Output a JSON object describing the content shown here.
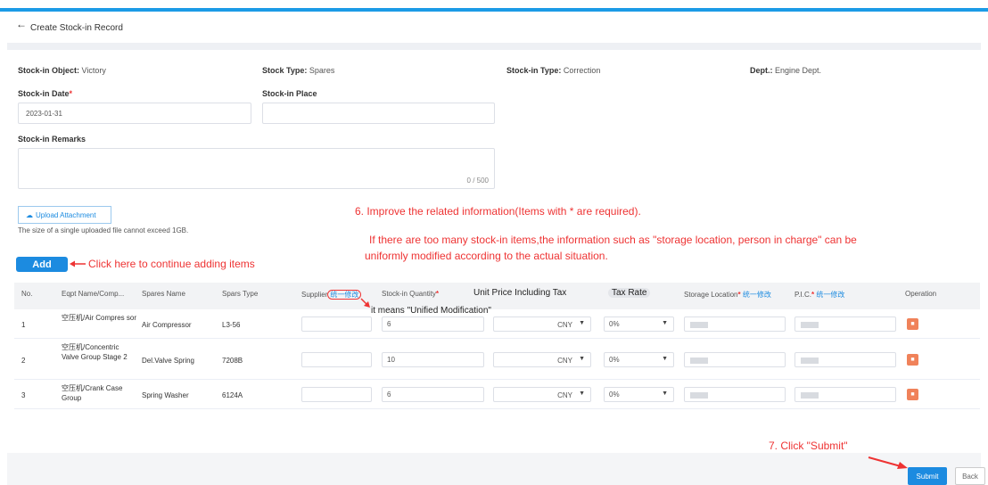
{
  "header": {
    "back_icon": "←",
    "title": "Create Stock-in Record"
  },
  "info": {
    "stock_in_object_label": "Stock-in Object:",
    "stock_in_object_value": "Victory",
    "stock_type_label": "Stock Type:",
    "stock_type_value": "Spares",
    "stock_in_type_label": "Stock-in Type:",
    "stock_in_type_value": "Correction",
    "dept_label": "Dept.:",
    "dept_value": "Engine Dept."
  },
  "form": {
    "date_label": "Stock-in Date",
    "date_value": "2023-01-31",
    "place_label": "Stock-in Place",
    "place_value": "",
    "remarks_label": "Stock-in Remarks",
    "remarks_counter": "0 / 500",
    "required_mark": "*"
  },
  "upload": {
    "button_label": "Upload Attachment",
    "icon": "upload-icon",
    "note": "The size of a single uploaded file cannot exceed 1GB."
  },
  "add_button_label": "Add",
  "annotations": {
    "step6": "6. Improve the related information(Items with * are required).",
    "step6_detail_line1": "If there are too many stock-in items,the information such as \"storage location, person in charge\" can be",
    "step6_detail_line2": "uniformly modified according to the actual situation.",
    "add_hint": "Click here to continue adding items",
    "unified_note": "it means  \"Unified Modification\"",
    "step7": "7. Click \"Submit\""
  },
  "table": {
    "columns": {
      "no": "No.",
      "eqpt": "Eqpt Name/Comp...",
      "spares": "Spares Name",
      "type": "Spars Type",
      "supplier": "Supplier",
      "unified": "统一修改",
      "quantity": "Stock-in Quantity",
      "price": "Unit Price Including Tax",
      "tax": "Tax Rate",
      "location": "Storage Location",
      "pic": "P.I.C.",
      "operation": "Operation"
    },
    "rows": [
      {
        "no": "1",
        "eqpt": "空压机/Air Compres sor",
        "spares": "Air Compressor",
        "type": "L3-56",
        "quantity": "6",
        "currency": "CNY",
        "tax": "0%"
      },
      {
        "no": "2",
        "eqpt": "空压机/Concentric Valve Group Stage 2",
        "spares": "Del.Valve Spring",
        "type": "7208B",
        "quantity": "10",
        "currency": "CNY",
        "tax": "0%"
      },
      {
        "no": "3",
        "eqpt": "空压机/Crank Case Group",
        "spares": "Spring Washer",
        "type": "6124A",
        "quantity": "6",
        "currency": "CNY",
        "tax": "0%"
      }
    ],
    "delete_icon": "trash-icon"
  },
  "footer": {
    "submit_label": "Submit",
    "back_label": "Back"
  },
  "colors": {
    "accent": "#1c8be0",
    "annotation": "#e33333",
    "delete": "#f0825a"
  }
}
